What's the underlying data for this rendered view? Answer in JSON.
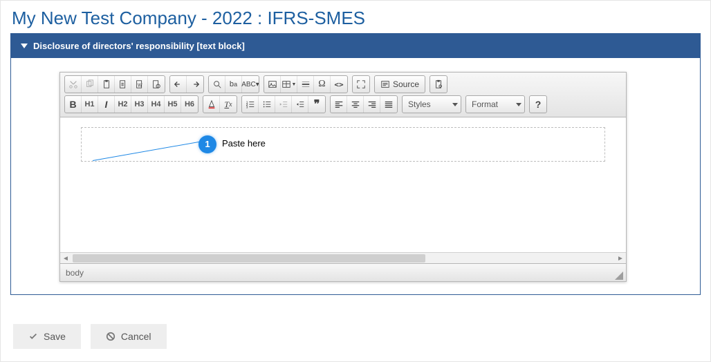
{
  "page_title": "My New Test Company - 2022 : IFRS-SMES",
  "panel_header": "Disclosure of directors' responsibility [text block]",
  "annotation": {
    "number": "1",
    "text": "Paste here"
  },
  "editor": {
    "path": "body",
    "source_label": "Source",
    "styles_label": "Styles",
    "format_label": "Format",
    "help_label": "?"
  },
  "buttons": {
    "save": "Save",
    "cancel": "Cancel"
  }
}
